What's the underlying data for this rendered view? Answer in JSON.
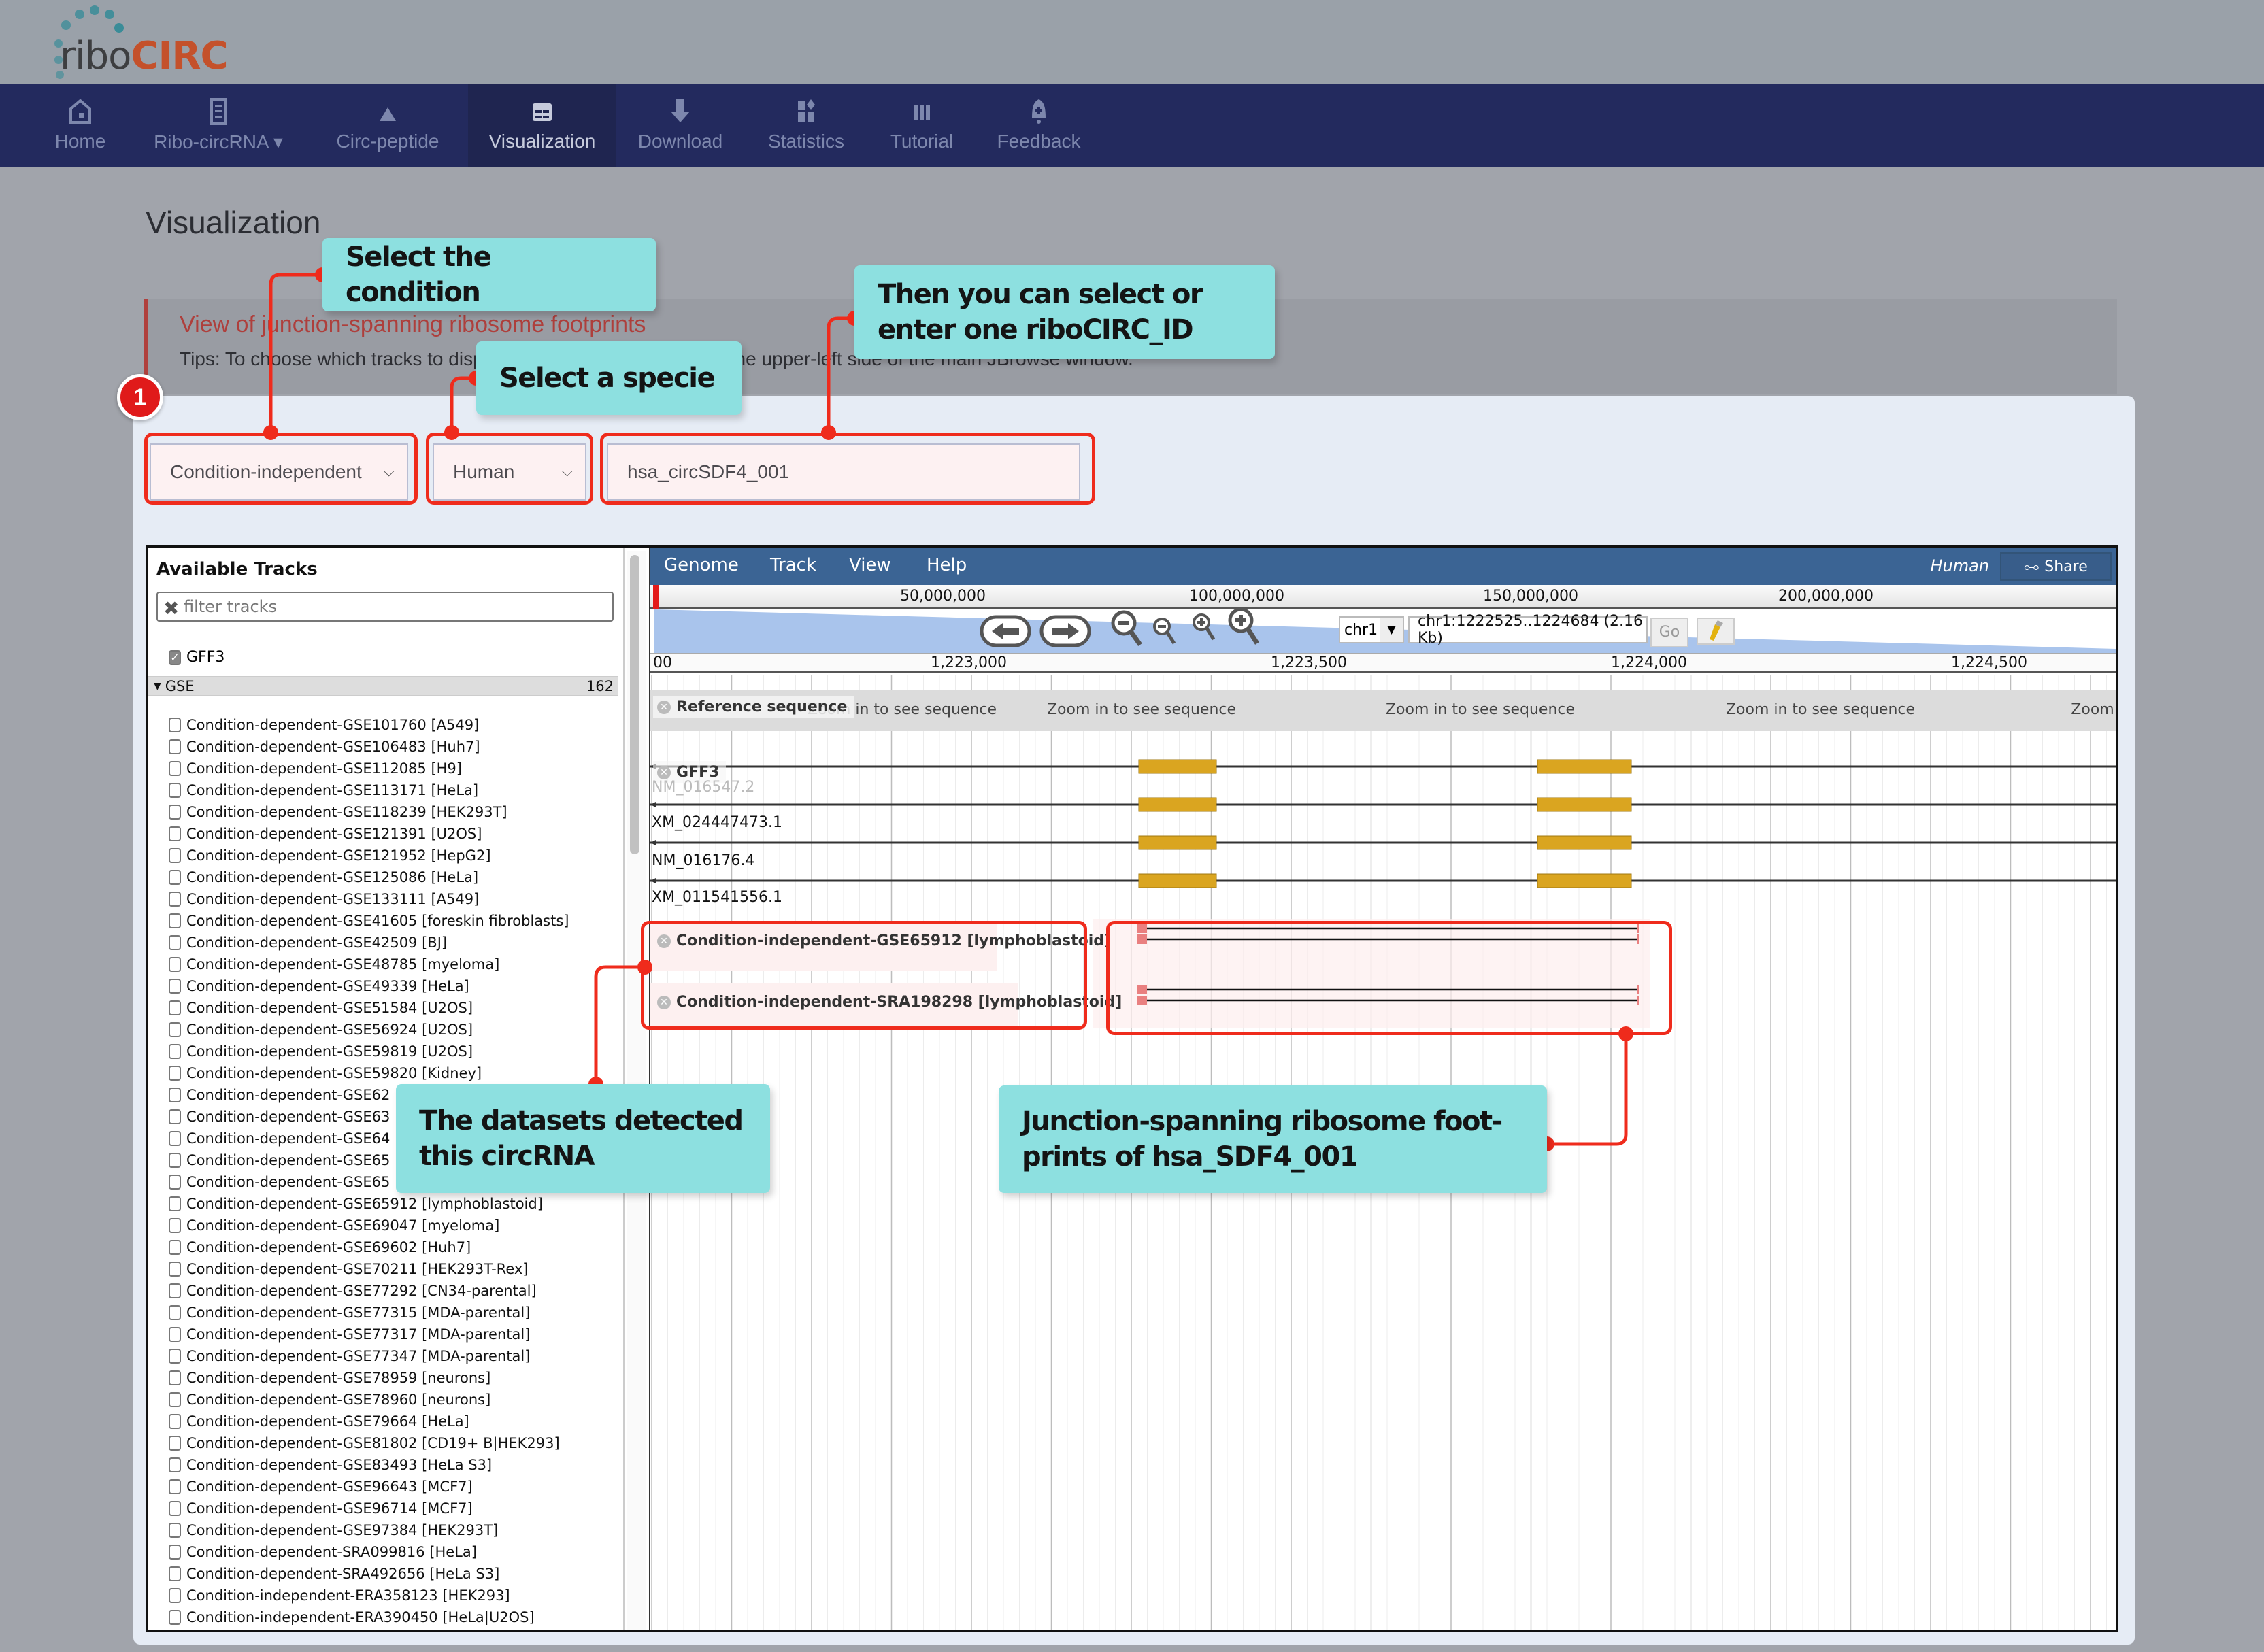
{
  "brand": {
    "prefix": "ribo",
    "suffix": "CIRC",
    "suffix_color": "#c4512b",
    "dot_color": "#3a8c98"
  },
  "nav": {
    "items": [
      {
        "label": "Home",
        "icon": "home-icon"
      },
      {
        "label": "Ribo-circRNA ▾",
        "icon": "document-icon"
      },
      {
        "label": "Circ-peptide",
        "icon": "mountain-icon"
      },
      {
        "label": "Visualization",
        "icon": "browser-window-icon",
        "active": true
      },
      {
        "label": "Download",
        "icon": "download-arrow-icon"
      },
      {
        "label": "Statistics",
        "icon": "chart-blocks-icon"
      },
      {
        "label": "Tutorial",
        "icon": "book-icon"
      },
      {
        "label": "Feedback",
        "icon": "bell-icon"
      }
    ],
    "bg_color": "#232a5e"
  },
  "page": {
    "title": "Visualization",
    "info_heading": "View of junction-spanning ribosome footprints",
    "info_tip": "Tips: To choose which tracks to display, use the track selector on the upper-left side of the main JBrowse window."
  },
  "form": {
    "condition": "Condition-independent",
    "species": "Human",
    "circ_id": "hsa_circSDF4_001"
  },
  "annotations": {
    "badge": "1",
    "select_condition": "Select the condition",
    "select_specie": "Select a specie",
    "select_id": "Then you can select or enter one riboCIRC_ID",
    "datasets": "The datasets detected this circRNA",
    "junction": "Junction-spanning ribosome foot-prints of hsa_SDF4_001",
    "highlight_color": "#ef2b1c",
    "callout_color": "#8de0e0"
  },
  "jbrowse": {
    "track_selector": {
      "title": "Available Tracks",
      "filter_placeholder": "filter tracks",
      "gff3_label": "GFF3",
      "gff3_checked": true,
      "group_label": "GSE",
      "group_count": "162",
      "tracks": [
        "Condition-dependent-GSE101760 [A549]",
        "Condition-dependent-GSE106483 [Huh7]",
        "Condition-dependent-GSE112085 [H9]",
        "Condition-dependent-GSE113171 [HeLa]",
        "Condition-dependent-GSE118239 [HEK293T]",
        "Condition-dependent-GSE121391 [U2OS]",
        "Condition-dependent-GSE121952 [HepG2]",
        "Condition-dependent-GSE125086 [HeLa]",
        "Condition-dependent-GSE133111 [A549]",
        "Condition-dependent-GSE41605 [foreskin fibroblasts]",
        "Condition-dependent-GSE42509 [BJ]",
        "Condition-dependent-GSE48785 [myeloma]",
        "Condition-dependent-GSE49339 [HeLa]",
        "Condition-dependent-GSE51584 [U2OS]",
        "Condition-dependent-GSE56924 [U2OS]",
        "Condition-dependent-GSE59819 [U2OS]",
        "Condition-dependent-GSE59820 [Kidney]",
        "Condition-dependent-GSE62",
        "Condition-dependent-GSE63",
        "Condition-dependent-GSE64",
        "Condition-dependent-GSE65",
        "Condition-dependent-GSE65",
        "Condition-dependent-GSE65912 [lymphoblastoid]",
        "Condition-dependent-GSE69047 [myeloma]",
        "Condition-dependent-GSE69602 [Huh7]",
        "Condition-dependent-GSE70211 [HEK293T-Rex]",
        "Condition-dependent-GSE77292 [CN34-parental]",
        "Condition-dependent-GSE77315 [MDA-parental]",
        "Condition-dependent-GSE77317 [MDA-parental]",
        "Condition-dependent-GSE77347 [MDA-parental]",
        "Condition-dependent-GSE78959 [neurons]",
        "Condition-dependent-GSE78960 [neurons]",
        "Condition-dependent-GSE79664 [HeLa]",
        "Condition-dependent-GSE81802 [CD19+ B|HEK293]",
        "Condition-dependent-GSE83493 [HeLa S3]",
        "Condition-dependent-GSE96643 [MCF7]",
        "Condition-dependent-GSE96714 [MCF7]",
        "Condition-dependent-GSE97384 [HEK293T]",
        "Condition-dependent-SRA099816 [HeLa]",
        "Condition-dependent-SRA492656 [HeLa S3]",
        "Condition-independent-ERA358123 [HEK293]",
        "Condition-independent-ERA390450 [HeLa|U2OS]"
      ]
    },
    "menu": [
      "Genome",
      "Track",
      "View",
      "Help"
    ],
    "species_label": "Human",
    "share_label": "Share",
    "overview_ticks": [
      "50,000,000",
      "100,000,000",
      "150,000,000",
      "200,000,000"
    ],
    "chromosome": "chr1",
    "location": "chr1:1222525..1224684 (2.16 Kb)",
    "go_label": "Go",
    "detail_ticks": [
      "00",
      "1,223,000",
      "1,223,500",
      "1,224,000",
      "1,224,500"
    ],
    "refseq_label": "Reference sequence",
    "zoom_hint": "Zoom in to see sequence",
    "zoom_hint_partial": "Zoom",
    "gff3_track_label": "GFF3",
    "transcripts": [
      "NM_016547.2",
      "XM_024447473.1",
      "NM_016176.4",
      "XM_011541556.1"
    ],
    "exon_color": "#daa520",
    "footprint_tracks": [
      "Condition-independent-GSE65912 [lymphoblastoid]",
      "Condition-independent-SRA198298 [lymphoblastoid]"
    ],
    "footprint_color": "#e98080"
  }
}
